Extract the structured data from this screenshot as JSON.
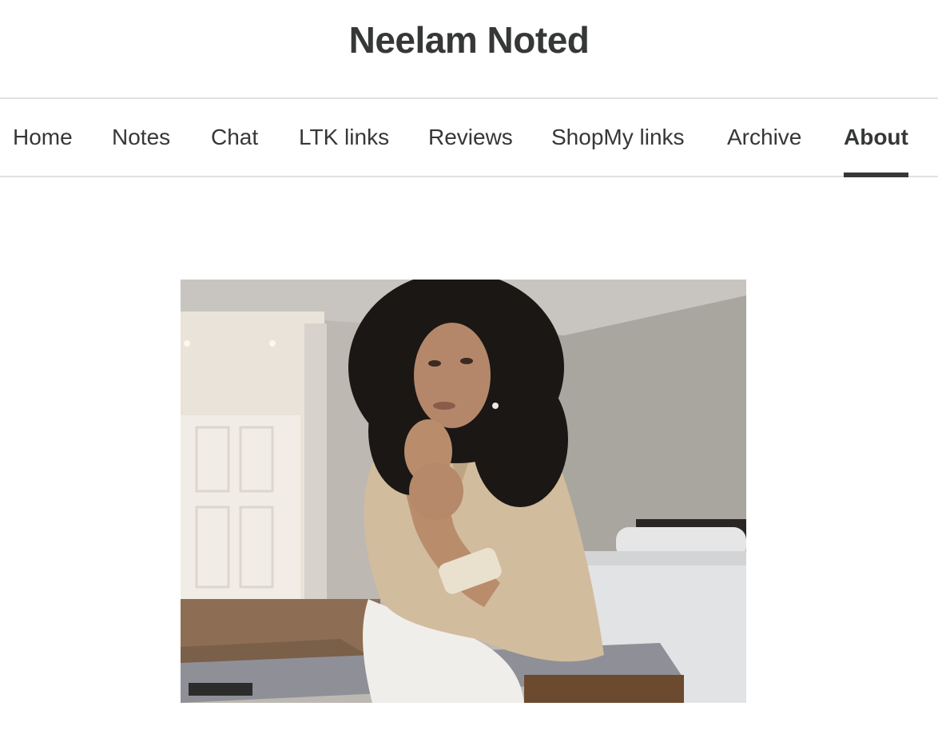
{
  "site": {
    "title": "Neelam Noted"
  },
  "nav": {
    "items": [
      {
        "label": "Home"
      },
      {
        "label": "Notes"
      },
      {
        "label": "Chat"
      },
      {
        "label": "LTK links"
      },
      {
        "label": "Reviews"
      },
      {
        "label": "ShopMy links"
      },
      {
        "label": "Archive"
      },
      {
        "label": "About",
        "active": true
      }
    ]
  },
  "colors": {
    "text": "#363737",
    "divider": "#e2e2e2",
    "background": "#ffffff"
  }
}
